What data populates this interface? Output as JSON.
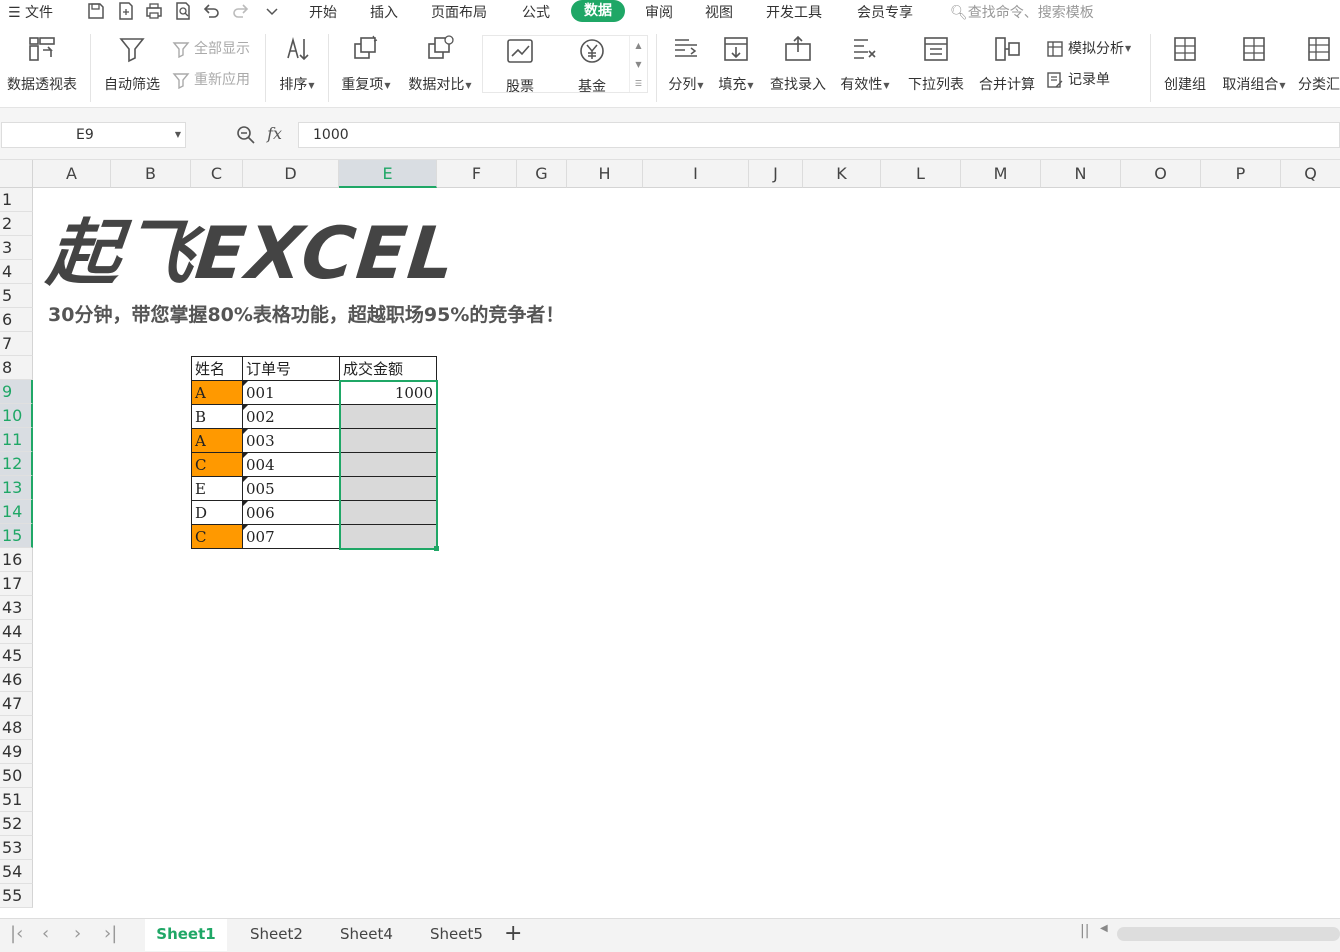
{
  "menubar": {
    "file": "文件",
    "tabs": [
      "开始",
      "插入",
      "页面布局",
      "公式",
      "数据",
      "审阅",
      "视图",
      "开发工具",
      "会员专享"
    ],
    "active_tab": "数据",
    "search_placeholder": "查找命令、搜索模板"
  },
  "ribbon": {
    "pivot": "数据透视表",
    "autofilter": "自动筛选",
    "show_all": "全部显示",
    "reapply": "重新应用",
    "sort": "排序",
    "duplicates": "重复项",
    "compare": "数据对比",
    "stocks": "股票",
    "funds": "基金",
    "split": "分列",
    "fill": "填充",
    "lookup": "查找录入",
    "validity": "有效性",
    "dropdown": "下拉列表",
    "consolidate": "合并计算",
    "simulate": "模拟分析",
    "record": "记录单",
    "group": "创建组",
    "ungroup": "取消组合",
    "subtotal": "分类汇"
  },
  "formulabar": {
    "cell_ref": "E9",
    "fx": "fx",
    "value": "1000"
  },
  "columns": [
    "A",
    "B",
    "C",
    "D",
    "E",
    "F",
    "G",
    "H",
    "I",
    "J",
    "K",
    "L",
    "M",
    "N",
    "O",
    "P",
    "Q"
  ],
  "selected_column": "E",
  "rows": [
    "1",
    "2",
    "3",
    "4",
    "5",
    "6",
    "7",
    "8",
    "9",
    "10",
    "11",
    "12",
    "13",
    "14",
    "15",
    "16",
    "17",
    "43",
    "44",
    "45",
    "46",
    "47",
    "48",
    "49",
    "50",
    "51",
    "52",
    "53",
    "54",
    "55"
  ],
  "sheet": {
    "logo": "起飞EXCEL",
    "subtitle": "30分钟，带您掌握80%表格功能，超越职场95%的竞争者！",
    "table": {
      "headers": [
        "姓名",
        "订单号",
        "成交金额"
      ],
      "rows": [
        {
          "name": "A",
          "order": "001",
          "amount": "1000",
          "highlight": true
        },
        {
          "name": "B",
          "order": "002",
          "amount": "",
          "highlight": false
        },
        {
          "name": "A",
          "order": "003",
          "amount": "",
          "highlight": true
        },
        {
          "name": "C",
          "order": "004",
          "amount": "",
          "highlight": true
        },
        {
          "name": "E",
          "order": "005",
          "amount": "",
          "highlight": false
        },
        {
          "name": "D",
          "order": "006",
          "amount": "",
          "highlight": false
        },
        {
          "name": "C",
          "order": "007",
          "amount": "",
          "highlight": true
        }
      ]
    }
  },
  "sheet_tabs": [
    "Sheet1",
    "Sheet2",
    "Sheet4",
    "Sheet5"
  ],
  "active_sheet": "Sheet1",
  "colors": {
    "accent": "#1fa766",
    "highlight": "#ff9900",
    "selection_fill": "#d9d9d9"
  }
}
